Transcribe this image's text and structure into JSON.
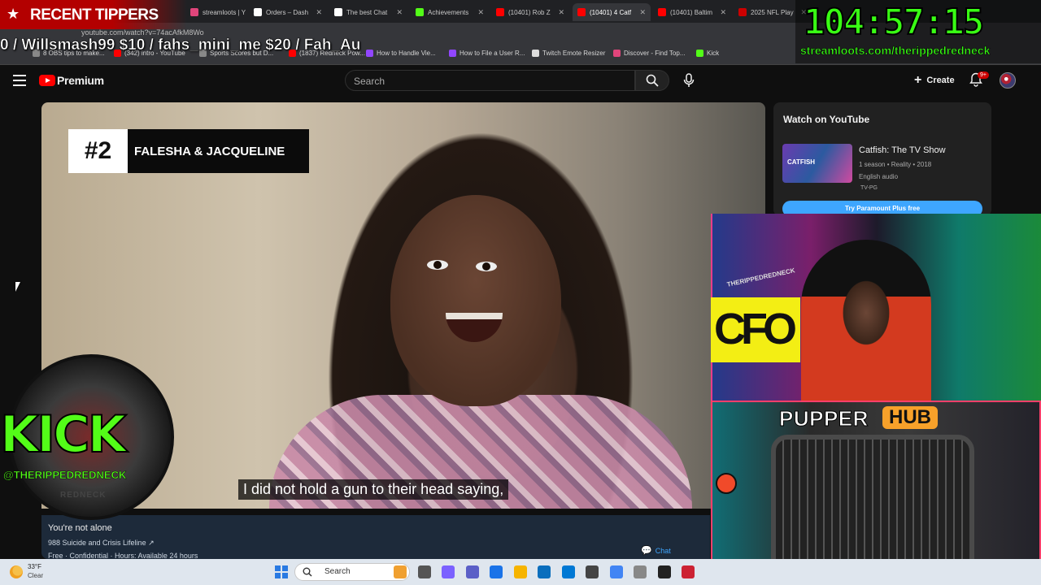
{
  "browser": {
    "tabs": [
      {
        "label": "streamloots | Y",
        "color": "#e0457b"
      },
      {
        "label": "Orders – Dash",
        "color": "#ffffff"
      },
      {
        "label": "The best Chat",
        "color": "#ffffff"
      },
      {
        "label": "Achievements",
        "color": "#53fc18"
      },
      {
        "label": "(10401) Rob Z",
        "color": "#ff0000"
      },
      {
        "label": "(10401) 4 Catf",
        "color": "#ff0000"
      },
      {
        "label": "(10401) Baltim",
        "color": "#ff0000"
      },
      {
        "label": "2025 NFL Play",
        "color": "#cc0000"
      }
    ],
    "url": "youtube.com/watch?v=74acAfkM8Wo",
    "bookmarks": [
      {
        "label": "8 OBS tips to make...",
        "color": "#888888"
      },
      {
        "label": "(342) intro - YouTube",
        "color": "#ff0000"
      },
      {
        "label": "Sports Scores but D...",
        "color": "#888888"
      },
      {
        "label": "(1837) Redneck Pow...",
        "color": "#ff0000"
      },
      {
        "label": "How to Handle Vie...",
        "color": "#9146ff"
      },
      {
        "label": "How to File a User R...",
        "color": "#9146ff"
      },
      {
        "label": "Twitch Emote Resizer",
        "color": "#dddddd"
      },
      {
        "label": "Discover - Find Top...",
        "color": "#e0457b"
      },
      {
        "label": "Kick",
        "color": "#53fc18"
      }
    ]
  },
  "youtube": {
    "brand": "Premium",
    "search_placeholder": "Search",
    "create_label": "Create",
    "notifications_badge": "9+"
  },
  "video": {
    "rank": "#2",
    "title_card": "FALESHA & JACQUELINE",
    "caption": "I did not hold a gun to their head saying,"
  },
  "info_panel": {
    "title": "You're not alone",
    "link": "988 Suicide and Crisis Lifeline ↗",
    "sub": "Free · Confidential · Hours: Available 24 hours",
    "chat_label": "Chat"
  },
  "sidebar": {
    "heading": "Watch on YouTube",
    "show_title": "Catfish: The TV Show",
    "show_meta": "1 season • Reality • 2018",
    "show_audio": "English audio",
    "show_rating": "TV-PG",
    "thumb_text": "CATFISH",
    "cta": "Try Paramount Plus free"
  },
  "overlays": {
    "tippers_label": "RECENT TIPPERS",
    "ticker": "0 / Willsmash99 $10 / fahs_mini_me $20 / Fah_Au",
    "timer": "104:57:15",
    "timer_url": "streamloots.com/therippedredneck",
    "kick_word": "KICK",
    "kick_handle": "@THERIPPEDREDNECK",
    "kick_sub": "REDNECK",
    "cam_handle": "THERIPPEDREDNECK",
    "cam_sign": "CFO",
    "pupper_title": "PUPPER",
    "pupper_hub": "HUB"
  },
  "taskbar": {
    "temp": "33°F",
    "weather": "Clear",
    "search": "Search",
    "icons": [
      "#f0a030",
      "#555555",
      "#7b61ff",
      "#5b5fc7",
      "#1a73e8",
      "#f6b400",
      "#0a6ebd",
      "#0078d4",
      "#444444",
      "#4285f4",
      "#888888",
      "#222222",
      "#cc2233"
    ]
  },
  "colors": {
    "youtube_red": "#ff0000",
    "kick_green": "#53fc18",
    "timer_green": "#39ff14",
    "pupper_orange": "#f7a12a",
    "link_blue": "#3ea6ff"
  }
}
